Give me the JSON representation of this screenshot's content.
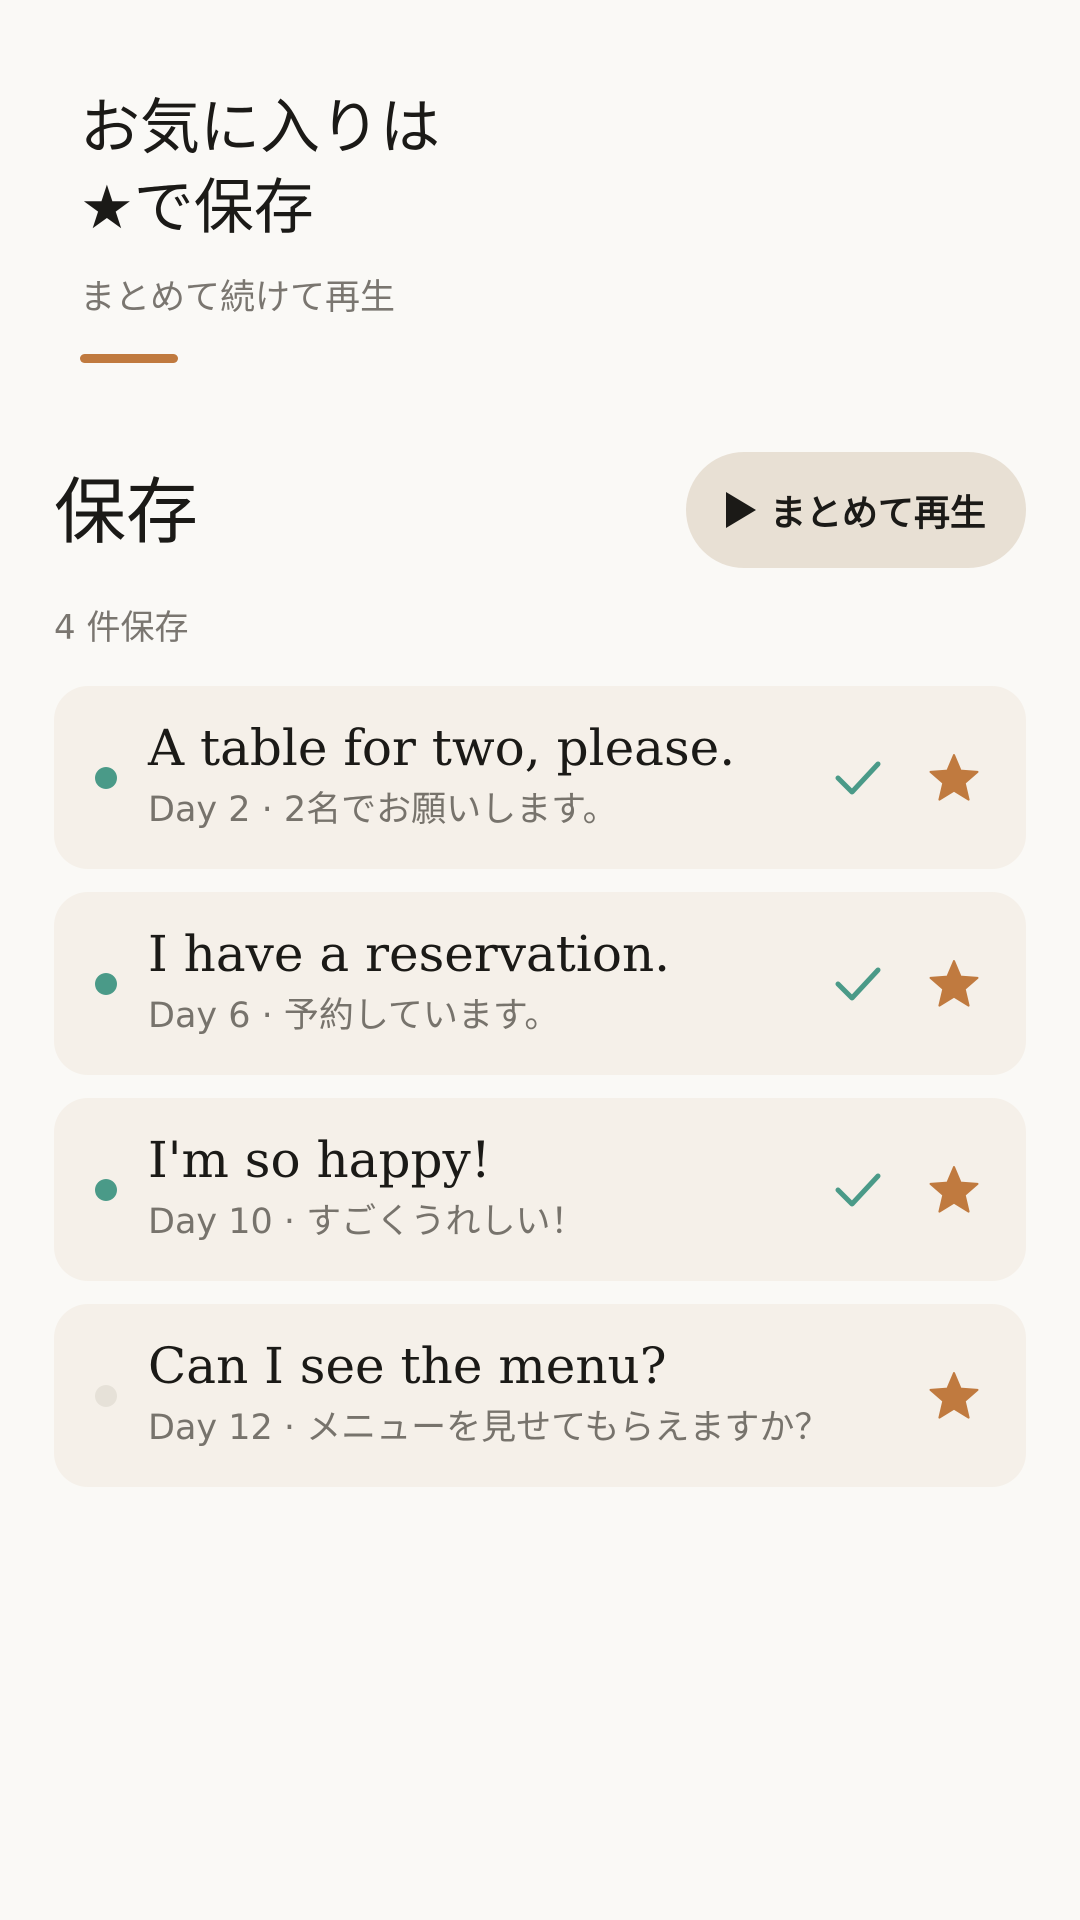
{
  "hero": {
    "title_line1": "お気に入りは",
    "title_line2": "★で保存",
    "subtitle": "まとめて続けて再生"
  },
  "section": {
    "title": "保存",
    "play_all_label": "まとめて再生",
    "count_label": "4 件保存"
  },
  "colors": {
    "accent": "#C07A3F",
    "learned": "#4A9A88",
    "card": "#F5F0E9",
    "background": "#FAF9F6"
  },
  "items": [
    {
      "phrase": "A table for two, please.",
      "meta": "Day 2 · 2名でお願いします。",
      "learned": true,
      "starred": true
    },
    {
      "phrase": "I have a reservation.",
      "meta": "Day 6 · 予約しています。",
      "learned": true,
      "starred": true
    },
    {
      "phrase": "I'm so happy!",
      "meta": "Day 10 · すごくうれしい！",
      "learned": true,
      "starred": true
    },
    {
      "phrase": "Can I see the menu?",
      "meta": "Day 12 · メニューを見せてもらえますか？",
      "learned": false,
      "starred": true
    }
  ]
}
